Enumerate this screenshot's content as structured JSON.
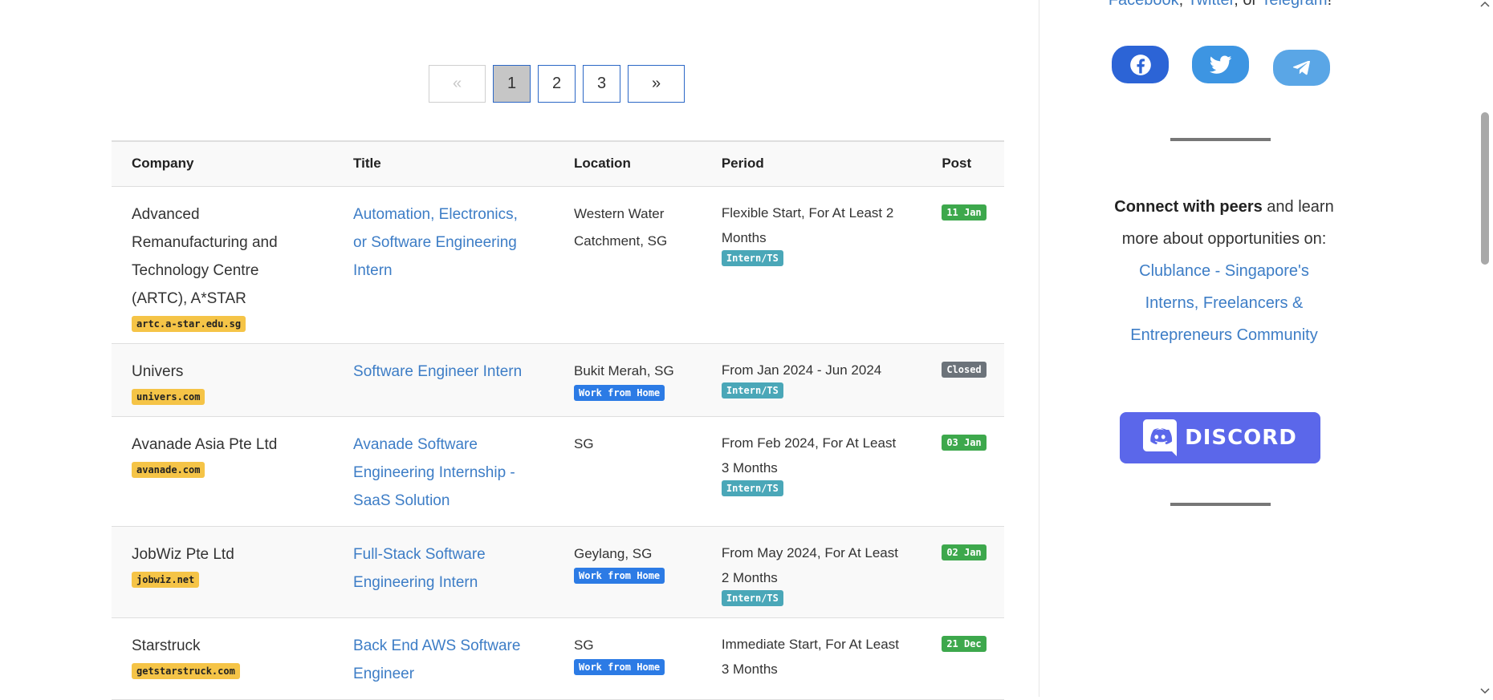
{
  "pagination": {
    "prev": "«",
    "pages": [
      "1",
      "2",
      "3"
    ],
    "active": "1",
    "next": "»"
  },
  "table": {
    "headers": {
      "company": "Company",
      "title": "Title",
      "location": "Location",
      "period": "Period",
      "post": "Post"
    },
    "rows": [
      {
        "company": "Advanced Remanufacturing and Technology Centre (ARTC), A*STAR",
        "domain": "artc.a-star.edu.sg",
        "title": "Automation, Electronics, or Software Engineering Intern",
        "location": "Western Water Catchment, SG",
        "period": "Flexible Start, For At Least 2 Months",
        "type_tag": "Intern/TS",
        "post": "11 Jan"
      },
      {
        "company": "Univers",
        "domain": "univers.com",
        "title": "Software Engineer Intern",
        "location": "Bukit Merah, SG",
        "wfh": "Work from Home",
        "period": "From Jan 2024 - Jun 2024",
        "type_tag": "Intern/TS",
        "post": "Closed"
      },
      {
        "company": "Avanade Asia Pte Ltd",
        "domain": "avanade.com",
        "title": "Avanade Software Engineering Internship - SaaS Solution",
        "location": "SG",
        "period": "From Feb 2024, For At Least 3 Months",
        "type_tag": "Intern/TS",
        "post": "03 Jan"
      },
      {
        "company": "JobWiz Pte Ltd",
        "domain": "jobwiz.net",
        "title": "Full-Stack Software Engineering Intern",
        "location": "Geylang, SG",
        "wfh": "Work from Home",
        "period": "From May 2024, For At Least 2 Months",
        "type_tag": "Intern/TS",
        "post": "02 Jan"
      },
      {
        "company": "Starstruck",
        "domain": "getstarstruck.com",
        "title": "Back End AWS Software Engineer",
        "location": "SG",
        "wfh": "Work from Home",
        "period": "Immediate Start, For At Least 3 Months",
        "post": "21 Dec"
      }
    ]
  },
  "sidebar": {
    "follow": {
      "facebook": "Facebook",
      "sep1": ", ",
      "twitter": "Twitter",
      "sep2": ", or ",
      "telegram": "Telegram",
      "end": "!"
    },
    "connect": {
      "bold": "Connect with peers",
      "rest": " and learn more about opportunities on:",
      "link": "Clublance - Singapore's Interns, Freelancers & Entrepreneurs Community"
    },
    "discord_label": "DISCORD"
  },
  "colors": {
    "link": "#3d7dc6",
    "active_page_bg": "#c6c6c6",
    "domain_tag": "#f5c447",
    "wfh_tag": "#2c7be5",
    "intern_tag": "#4aa7b8",
    "post_green": "#3da84c",
    "post_closed": "#6c737a",
    "facebook": "#2c64d6",
    "twitter": "#3d95e2",
    "telegram": "#5aa6e6",
    "discord": "#5b67ea"
  },
  "icons": [
    "facebook-icon",
    "twitter-icon",
    "telegram-icon",
    "discord-icon"
  ]
}
